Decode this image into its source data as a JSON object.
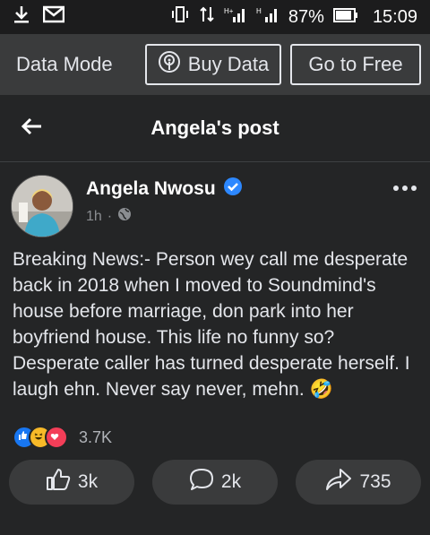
{
  "status": {
    "battery": "87%",
    "time": "15:09"
  },
  "databar": {
    "mode_label": "Data Mode",
    "buy_label": "Buy Data",
    "free_label": "Go to Free"
  },
  "header": {
    "title": "Angela's post"
  },
  "post": {
    "author": "Angela Nwosu",
    "time": "1h",
    "separator": "·",
    "text": "Breaking News:- Person wey call me desperate back in 2018 when I moved to Soundmind's house before marriage, don park into her boyfriend house. This life no funny so? Desperate caller has turned desperate herself. I laugh ehn. Never say never, mehn. 🤣",
    "reaction_count": "3.7K"
  },
  "actions": {
    "like_count": "3k",
    "comment_count": "2k",
    "share_count": "735"
  },
  "colors": {
    "verified": "#2d88ff",
    "like": "#1877f2",
    "love": "#f33e58",
    "haha": "#f7b928"
  }
}
